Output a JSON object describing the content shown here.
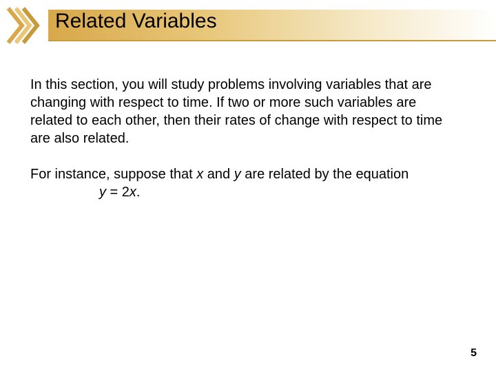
{
  "header": {
    "title": "Related Variables"
  },
  "body": {
    "p1": "In this section, you will study problems involving variables that are changing with respect to time. If two or more such variables are related to each other, then their rates of change with respect to time are also related.",
    "p2_pre": "For instance, suppose that ",
    "p2_var1": "x",
    "p2_mid": " and ",
    "p2_var2": "y",
    "p2_post": " are related by the equation",
    "eq_lhs": "y",
    "eq_eq": " = 2",
    "eq_rhs": "x",
    "eq_end": "."
  },
  "page_number": "5",
  "colors": {
    "gold_dark": "#c99a3a",
    "gold_mid": "#d8a84a",
    "gold_light": "#f0dca8"
  }
}
